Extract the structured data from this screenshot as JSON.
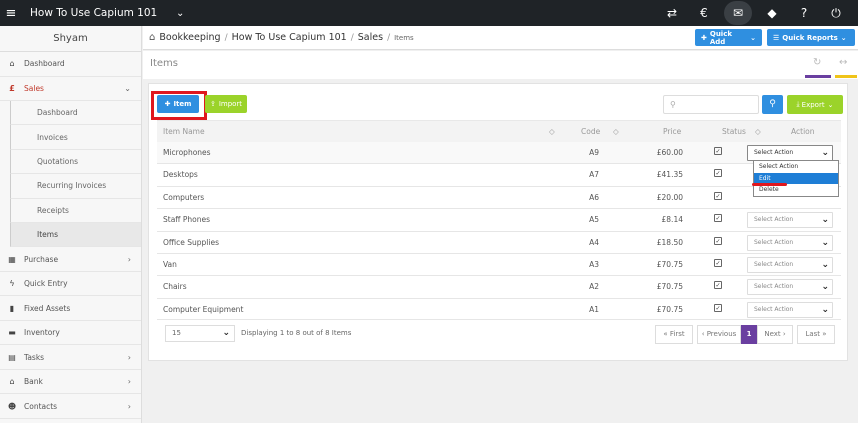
{
  "topbar": {
    "menu_icon": "hamburger-icon",
    "app_title": "How To Use Capium 101",
    "caret": "⌵"
  },
  "sidebar": {
    "user_name": "Shyam",
    "items": [
      {
        "icon": "dashboard-icon",
        "label": "Dashboard"
      },
      {
        "icon": "pound-icon",
        "label": "Sales"
      },
      {
        "icon": "purchase-icon",
        "label": "Purchase"
      },
      {
        "icon": "quick-entry-icon",
        "label": "Quick Entry"
      },
      {
        "icon": "fixed-assets-icon",
        "label": "Fixed Assets"
      },
      {
        "icon": "inventory-icon",
        "label": "Inventory"
      },
      {
        "icon": "tasks-icon",
        "label": "Tasks"
      },
      {
        "icon": "bank-icon",
        "label": "Bank"
      },
      {
        "icon": "contacts-icon",
        "label": "Contacts"
      }
    ],
    "sales_sub": [
      "Dashboard",
      "Invoices",
      "Quotations",
      "Recurring Invoices",
      "Receipts",
      "Items"
    ]
  },
  "breadcrumb": {
    "items": [
      "Bookkeeping",
      "How To Use Capium 101",
      "Sales",
      "Items"
    ],
    "quick_add": "Quick Add",
    "quick_reports": "Quick Reports"
  },
  "page": {
    "title": "Items"
  },
  "toolbar": {
    "item_button": "Item",
    "import_button": "Import",
    "search_placeholder": "",
    "export_button": "Export"
  },
  "table": {
    "headers": {
      "name": "Item Name",
      "code": "Code",
      "price": "Price",
      "status": "Status",
      "action": "Action"
    },
    "select_placeholder": "Select Action",
    "rows": [
      {
        "name": "Microphones",
        "code": "A9",
        "price": "£60.00"
      },
      {
        "name": "Desktops",
        "code": "A7",
        "price": "£41.35"
      },
      {
        "name": "Computers",
        "code": "A6",
        "price": "£20.00"
      },
      {
        "name": "Staff Phones",
        "code": "A5",
        "price": "£8.14"
      },
      {
        "name": "Office Supplies",
        "code": "A4",
        "price": "£18.50"
      },
      {
        "name": "Van",
        "code": "A3",
        "price": "£70.75"
      },
      {
        "name": "Chairs",
        "code": "A2",
        "price": "£70.75"
      },
      {
        "name": "Computer Equipment",
        "code": "A1",
        "price": "£70.75"
      }
    ],
    "dropdown_options": [
      "Select Action",
      "Edit",
      "Delete"
    ]
  },
  "footer": {
    "page_size": "15",
    "showing": "Displaying 1 to 8 out of 8 Items",
    "first": "« First",
    "previous": "‹ Previous",
    "current_page": "1",
    "next": "Next ›",
    "last": "Last »"
  },
  "colors": {
    "primary": "#2f8fe0",
    "green": "#9bd32a",
    "purple": "#6a3fa0",
    "highlight_red": "#e0171e"
  }
}
